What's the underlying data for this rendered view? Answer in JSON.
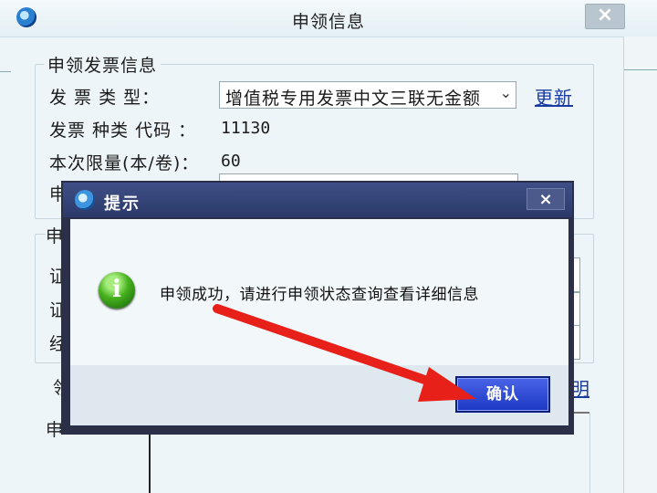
{
  "window": {
    "title": "申领信息",
    "close_label": "×"
  },
  "invoice_group": {
    "legend": "申领发票信息",
    "type_label": "发 票 类 型：",
    "type_value": "增值税专用发票中文三联无金额",
    "update_link": "更新",
    "code_label": "发票 种类 代码 ：",
    "code_value": "11130",
    "limit_label": "本次限量(本/卷)：",
    "limit_value": "60",
    "partial_label": "申"
  },
  "second_group": {
    "legend_fragment": "申",
    "row_fragments": [
      "证",
      "证",
      "经"
    ],
    "bottom_fragment": "领",
    "bottom_link_fragment": "明",
    "tree_fragment": "申"
  },
  "dialog": {
    "title": "提示",
    "close_label": "×",
    "message": "申领成功，请进行申领状态查询查看详细信息",
    "info_glyph": "i",
    "confirm_label": "确认"
  },
  "annotation": {
    "arrow_color": "#e8201a",
    "icon": "red-arrow-icon"
  },
  "colors": {
    "dialog_titlebar": "#2c3a6a",
    "confirm_button": "#1d38c4",
    "info_icon": "#46b11d",
    "link": "#1a3b9f"
  }
}
